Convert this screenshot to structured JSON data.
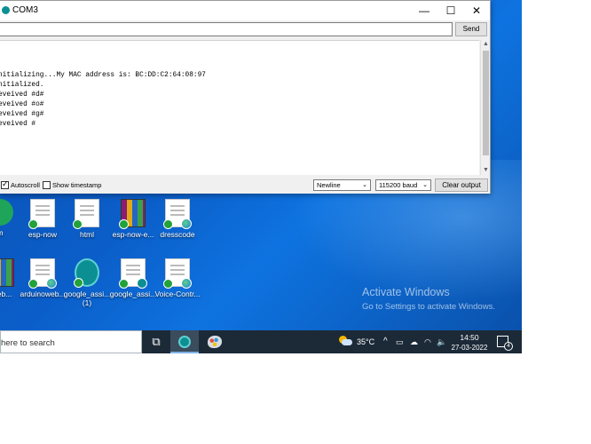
{
  "window": {
    "title": "COM3",
    "minimize_glyph": "—",
    "maximize_glyph": "☐",
    "close_glyph": "✕"
  },
  "serial": {
    "input_value": "",
    "send_label": "Send",
    "output_lines": [
      "nitializing...My MAC address is: BC:DD:C2:64:08:97",
      "nitialized.",
      "eveived #d#",
      "eveived #o#",
      "eveived #g#",
      "eveived #",
      ""
    ],
    "autoscroll_label": "Autoscroll",
    "autoscroll_checked": true,
    "timestamp_label": "Show timestamp",
    "timestamp_checked": false,
    "line_ending": "Newline",
    "baud_rate": "115200 baud",
    "clear_label": "Clear output"
  },
  "desktop": {
    "icons_row1": [
      {
        "label": "m",
        "icon": "green-app-icon"
      },
      {
        "label": "esp-now",
        "icon": "document-icon"
      },
      {
        "label": "html",
        "icon": "document-icon"
      },
      {
        "label": "esp-now-e...",
        "icon": "winrar-icon"
      },
      {
        "label": "dresscode",
        "icon": "edge-document-icon"
      }
    ],
    "icons_row2": [
      {
        "label": "web...",
        "icon": "winrar-icon"
      },
      {
        "label": "arduinoweb...",
        "icon": "edge-document-icon"
      },
      {
        "label": "google_assi... (1)",
        "icon": "arduino-icon"
      },
      {
        "label": "google_assi...",
        "icon": "arduino-document-icon"
      },
      {
        "label": "Voice-Contr...",
        "icon": "edge-document-icon"
      }
    ],
    "activate_title": "Activate Windows",
    "activate_sub": "Go to Settings to activate Windows."
  },
  "taskbar": {
    "search_text": "here to search",
    "temperature": "35°C",
    "time": "14:50",
    "date": "27-03-2022",
    "notification_count": "4"
  },
  "colors": {
    "desktop_bg": "#0b5ec9",
    "taskbar_bg": "#1c2a38",
    "arduino_teal": "#0b8f93"
  }
}
